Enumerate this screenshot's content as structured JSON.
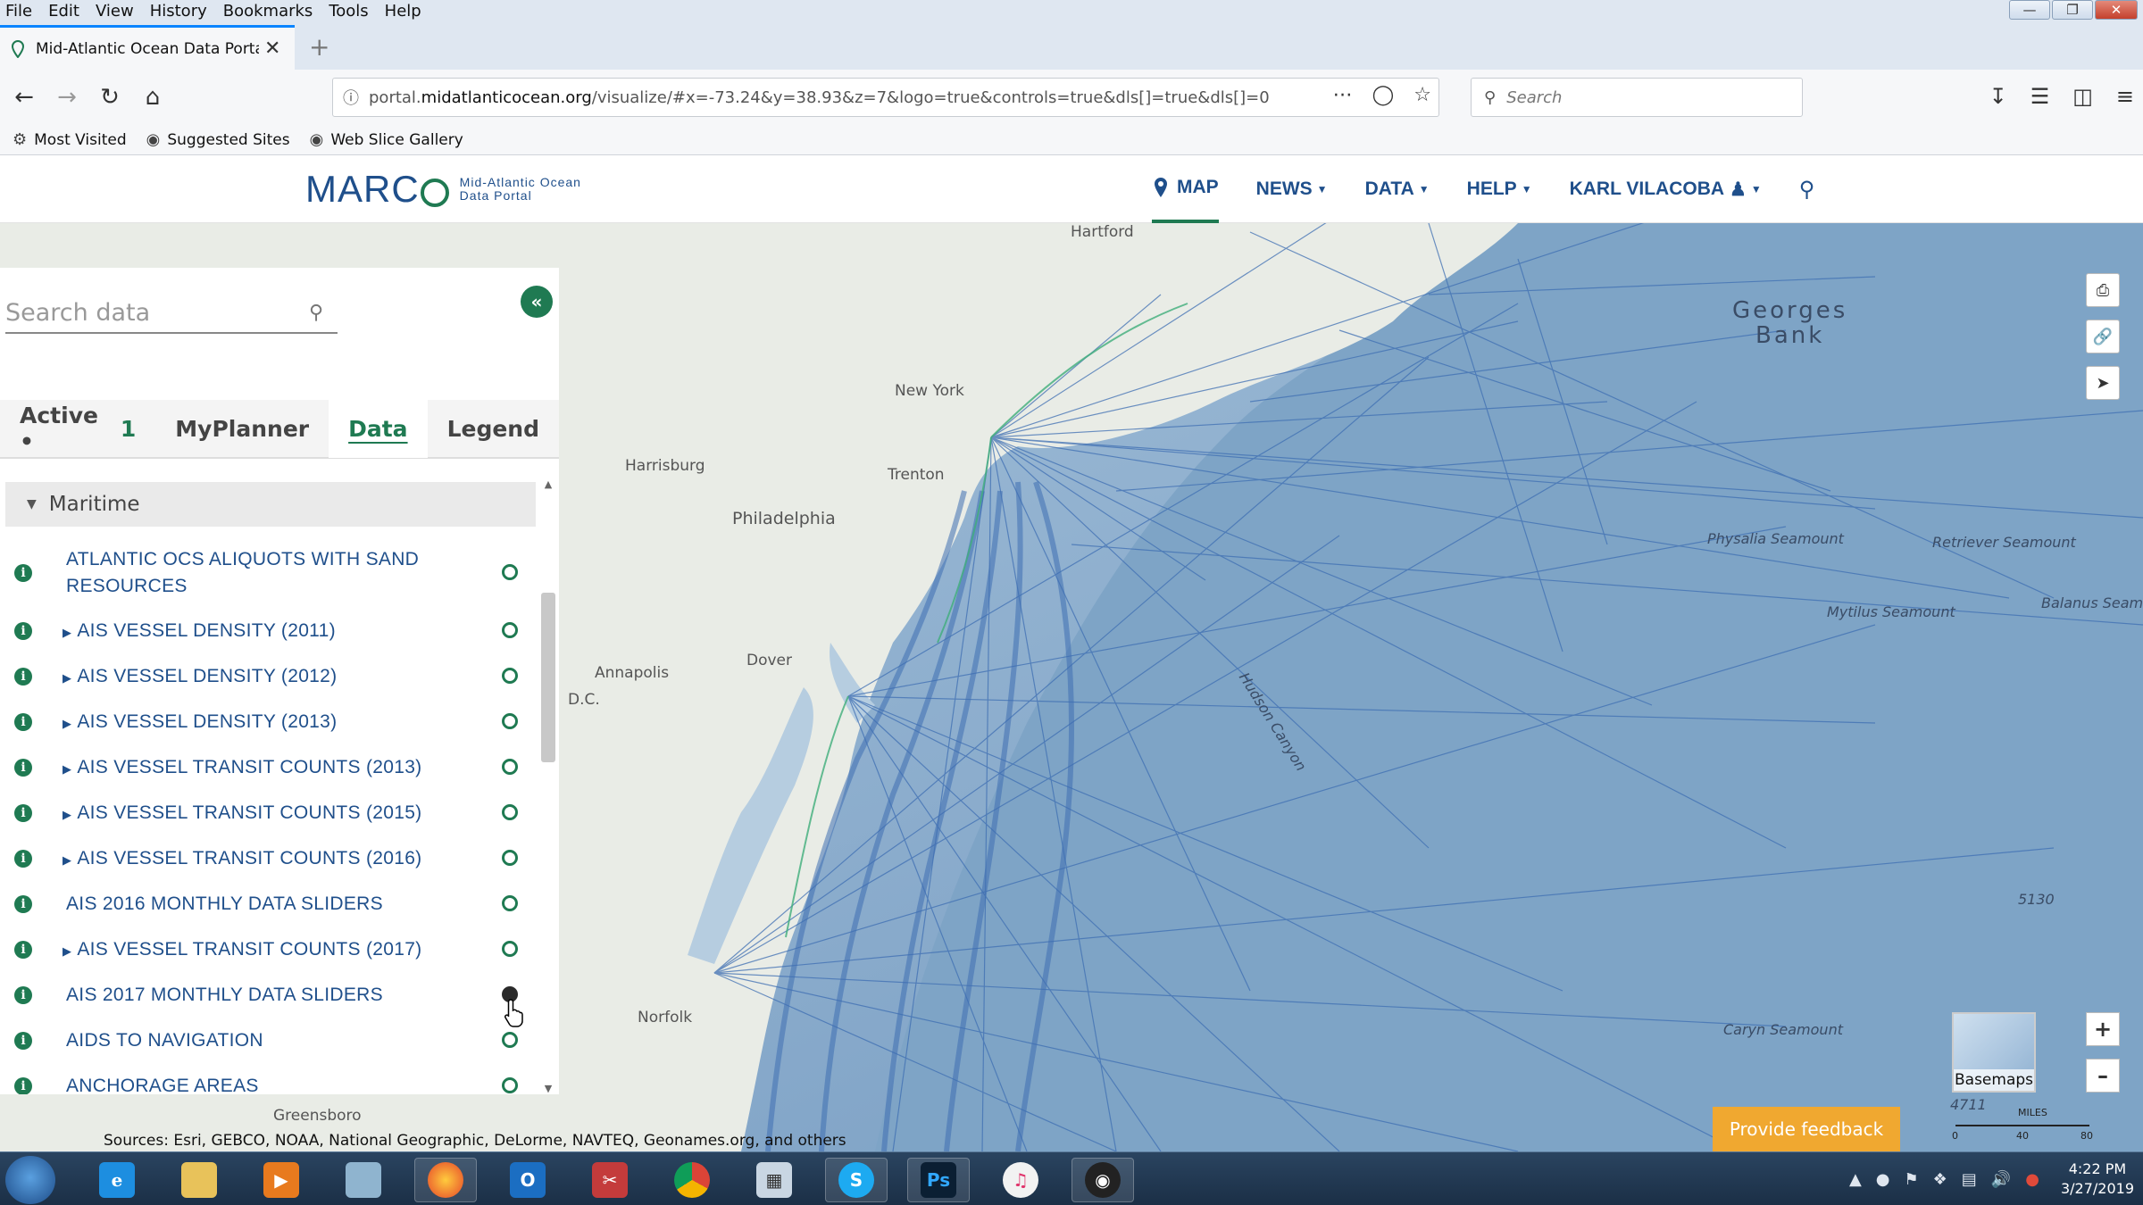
{
  "browser": {
    "menus": [
      "File",
      "Edit",
      "View",
      "History",
      "Bookmarks",
      "Tools",
      "Help"
    ],
    "tab_title": "Mid-Atlantic Ocean Data Portal",
    "url_prefix": "portal.",
    "url_host": "midatlanticocean.org",
    "url_rest": "/visualize/#x=-73.24&y=38.93&z=7&logo=true&controls=true&dls[]=true&dls[]=0",
    "search_placeholder": "Search",
    "bookmarks": [
      "Most Visited",
      "Suggested Sites",
      "Web Slice Gallery"
    ]
  },
  "site": {
    "logo_text": "MARC",
    "logo_sub_line1": "Mid-Atlantic Ocean",
    "logo_sub_line2": "Data Portal",
    "nav": [
      {
        "label": "MAP",
        "active": true
      },
      {
        "label": "NEWS"
      },
      {
        "label": "DATA"
      },
      {
        "label": "HELP"
      },
      {
        "label": "KARL VILACOBA"
      }
    ]
  },
  "panel": {
    "search_placeholder": "Search data",
    "tabs": {
      "active_label": "Active •",
      "active_count": "1",
      "myplanner": "MyPlanner",
      "data": "Data",
      "legend": "Legend"
    },
    "category": "Maritime",
    "layers": [
      {
        "name": "ATLANTIC OCS ALIQUOTS WITH SAND RESOURCES",
        "expandable": false,
        "on": false
      },
      {
        "name": "AIS VESSEL DENSITY (2011)",
        "expandable": true,
        "on": false
      },
      {
        "name": "AIS VESSEL DENSITY (2012)",
        "expandable": true,
        "on": false
      },
      {
        "name": "AIS VESSEL DENSITY (2013)",
        "expandable": true,
        "on": false
      },
      {
        "name": "AIS VESSEL TRANSIT COUNTS (2013)",
        "expandable": true,
        "on": false
      },
      {
        "name": "AIS VESSEL TRANSIT COUNTS (2015)",
        "expandable": true,
        "on": false
      },
      {
        "name": "AIS VESSEL TRANSIT COUNTS (2016)",
        "expandable": true,
        "on": false
      },
      {
        "name": "AIS 2016 MONTHLY DATA SLIDERS",
        "expandable": false,
        "on": false
      },
      {
        "name": "AIS VESSEL TRANSIT COUNTS (2017)",
        "expandable": true,
        "on": false
      },
      {
        "name": "AIS 2017 MONTHLY DATA SLIDERS",
        "expandable": false,
        "on": true
      },
      {
        "name": "AIDS TO NAVIGATION",
        "expandable": false,
        "on": false
      },
      {
        "name": "ANCHORAGE AREAS",
        "expandable": false,
        "on": false
      }
    ]
  },
  "map": {
    "labels": {
      "hartford": "Hartford",
      "new_york": "New York",
      "harrisburg": "Harrisburg",
      "trenton": "Trenton",
      "philadelphia": "Philadelphia",
      "annapolis": "Annapolis",
      "dc": "D.C.",
      "dover": "Dover",
      "norfolk": "Norfolk",
      "greensboro": "Greensboro",
      "georges_bank_1": "Georges",
      "georges_bank_2": "Bank",
      "hudson_canyon": "Hudson Canyon",
      "physalia": "Physalia Seamount",
      "retriever": "Retriever Seamount",
      "mytilus": "Mytilus Seamount",
      "balanus": "Balanus Seamo",
      "caryn": "Caryn Seamount",
      "depth_5130": "5130",
      "depth_4711": "4711"
    },
    "basemaps_label": "Basemaps",
    "feedback_label": "Provide feedback",
    "scale": {
      "units": "MILES",
      "ticks": [
        "0",
        "40",
        "80"
      ]
    },
    "attribution": "Sources: Esri, GEBCO, NOAA, National Geographic, DeLorme, NAVTEQ, Geonames.org, and others"
  },
  "taskbar": {
    "time": "4:22 PM",
    "date": "3/27/2019",
    "apps": [
      "internet-explorer",
      "file-explorer",
      "media-player",
      "notepad",
      "firefox",
      "outlook",
      "snipping-tool",
      "chrome",
      "calculator",
      "skype",
      "photoshop",
      "itunes",
      "obs"
    ]
  },
  "colors": {
    "brand_blue": "#1f4f8b",
    "brand_green": "#1f7a52",
    "land": "#e9ece6",
    "ocean_shelf": "#9cb9d3",
    "ocean_deep": "#7ea4c6",
    "vessel_tracks": "#3f6fb3"
  }
}
